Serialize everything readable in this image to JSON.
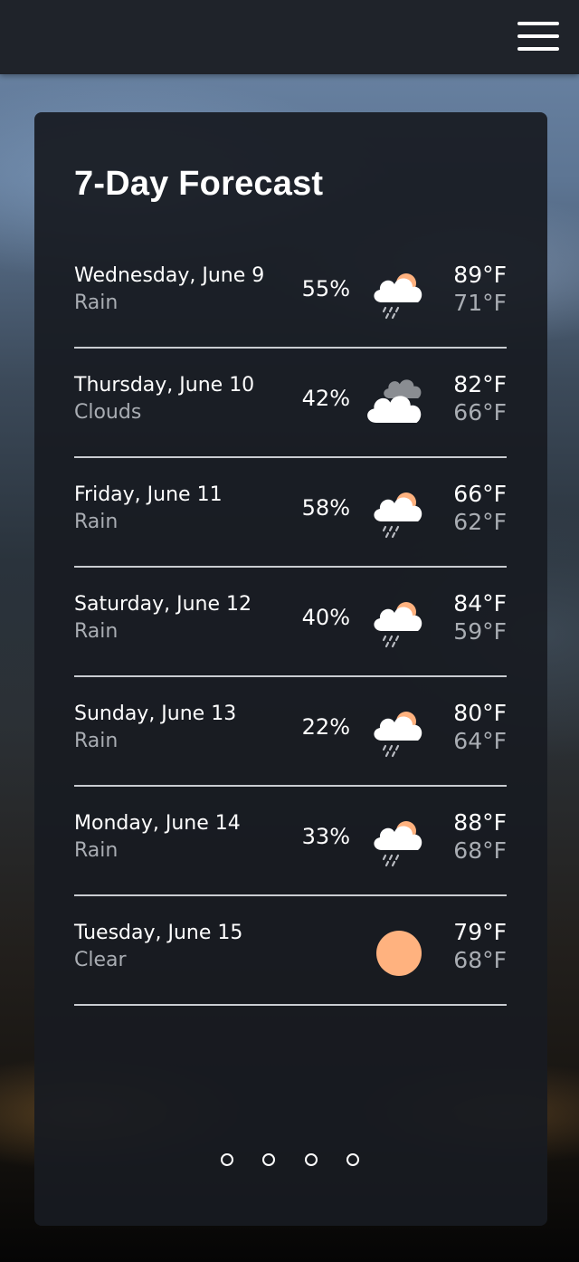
{
  "header": {
    "menu_icon": "hamburger-menu-icon"
  },
  "forecast": {
    "title": "7-Day Forecast",
    "days": [
      {
        "day": "Wednesday, June 9",
        "condition": "Rain",
        "precip": "55%",
        "icon": "rain-cloud-sun-icon",
        "high": "89°F",
        "low": "71°F"
      },
      {
        "day": "Thursday, June 10",
        "condition": "Clouds",
        "precip": "42%",
        "icon": "clouds-icon",
        "high": "82°F",
        "low": "66°F"
      },
      {
        "day": "Friday, June 11",
        "condition": "Rain",
        "precip": "58%",
        "icon": "rain-cloud-sun-icon",
        "high": "66°F",
        "low": "62°F"
      },
      {
        "day": "Saturday, June 12",
        "condition": "Rain",
        "precip": "40%",
        "icon": "rain-cloud-sun-icon",
        "high": "84°F",
        "low": "59°F"
      },
      {
        "day": "Sunday, June 13",
        "condition": "Rain",
        "precip": "22%",
        "icon": "rain-cloud-sun-icon",
        "high": "80°F",
        "low": "64°F"
      },
      {
        "day": "Monday, June 14",
        "condition": "Rain",
        "precip": "33%",
        "icon": "rain-cloud-sun-icon",
        "high": "88°F",
        "low": "68°F"
      },
      {
        "day": "Tuesday, June 15",
        "condition": "Clear",
        "precip": "",
        "icon": "sun-icon",
        "high": "79°F",
        "low": "68°F"
      }
    ]
  },
  "pagination": {
    "pages": 4,
    "active_page": 4
  },
  "colors": {
    "sun": "#ffb27f",
    "cloud": "#ffffff",
    "dark_cloud": "#8a8d92",
    "rain": "#b9bcc2",
    "card_bg": "#181b21",
    "divider": "#c9ccd1",
    "secondary_text": "#a9adb3"
  }
}
